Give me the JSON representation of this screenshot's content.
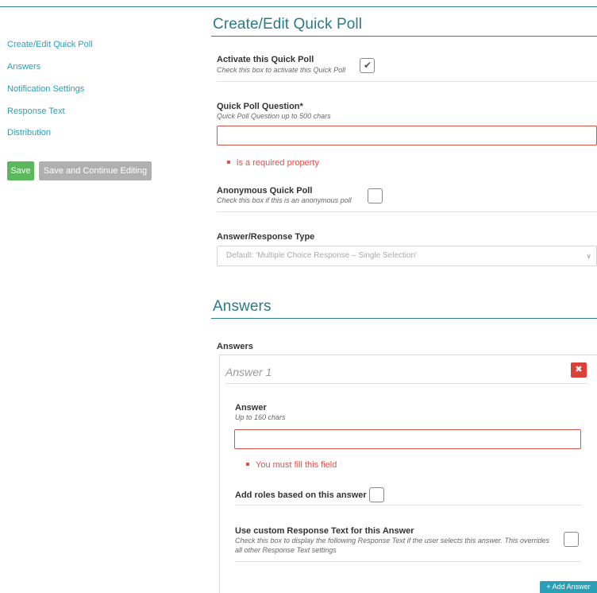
{
  "sidebar": {
    "links": [
      {
        "label": "Create/Edit Quick Poll"
      },
      {
        "label": "Answers"
      },
      {
        "label": "Notification Settings"
      },
      {
        "label": "Response Text"
      },
      {
        "label": "Distribution"
      }
    ],
    "save_label": "Save",
    "save_continue_label": "Save and Continue Editing"
  },
  "create_section": {
    "title": "Create/Edit Quick Poll",
    "activate": {
      "label": "Activate this Quick Poll",
      "help": "Check this box to activate this Quick Poll",
      "checked": true
    },
    "question": {
      "label": "Quick Poll Question*",
      "help": "Quick Poll Question up to 500 chars",
      "value": "",
      "error": "is a required property"
    },
    "anonymous": {
      "label": "Anonymous Quick Poll",
      "help": "Check this box if this is an anonymous poll",
      "checked": false
    },
    "response_type": {
      "label": "Answer/Response Type",
      "selected": "Default: 'Multiple Choice Response – Single Selection'"
    }
  },
  "answers_section": {
    "title": "Answers",
    "list_label": "Answers",
    "answer_panel": {
      "title": "Answer 1",
      "delete_icon": "✖",
      "answer_label": "Answer",
      "answer_help": "Up to 160 chars",
      "answer_value": "",
      "answer_error": "You must fill this field",
      "roles_label": "Add roles based on this answer",
      "custom_text_label": "Use custom Response Text for this Answer",
      "custom_text_help_1": "Check this box to display the following Response Text if the user selects this answer. This overrides",
      "custom_text_help_2": "all other Response Text settings"
    },
    "add_answer_label": "+ Add Answer"
  },
  "icons": {
    "checkmark": "✔",
    "chevron": "∨"
  },
  "colors": {
    "accent": "#2a9fb6",
    "heading": "#2a7a8a",
    "save": "#5cb85c",
    "disabled": "#b0b0b0",
    "error": "#d9534f"
  }
}
